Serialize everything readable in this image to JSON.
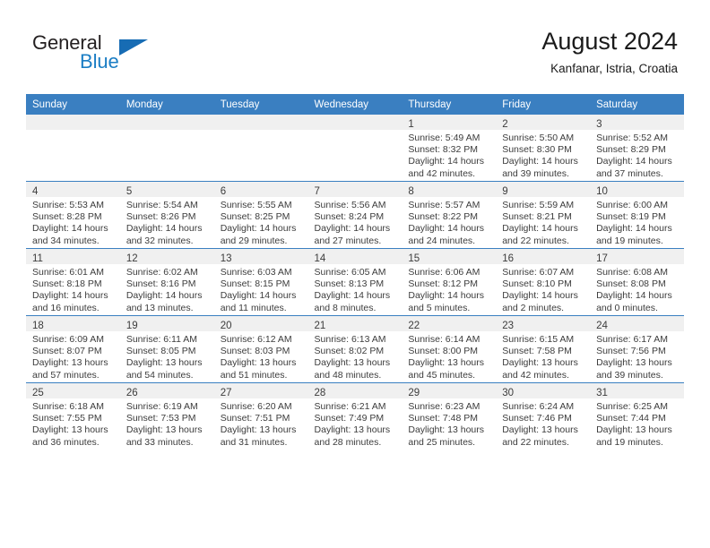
{
  "brand": {
    "name_part1": "General",
    "name_part2": "Blue",
    "triangle_color": "#176cb4",
    "blue_color": "#1a7dc4"
  },
  "header": {
    "month_title": "August 2024",
    "location": "Kanfanar, Istria, Croatia",
    "header_bg_color": "#3a7fc1"
  },
  "calendar": {
    "weekday_headers": [
      "Sunday",
      "Monday",
      "Tuesday",
      "Wednesday",
      "Thursday",
      "Friday",
      "Saturday"
    ],
    "weeks": [
      [
        {
          "day": "",
          "lines": []
        },
        {
          "day": "",
          "lines": []
        },
        {
          "day": "",
          "lines": []
        },
        {
          "day": "",
          "lines": []
        },
        {
          "day": "1",
          "lines": [
            "Sunrise: 5:49 AM",
            "Sunset: 8:32 PM",
            "Daylight: 14 hours",
            "and 42 minutes."
          ]
        },
        {
          "day": "2",
          "lines": [
            "Sunrise: 5:50 AM",
            "Sunset: 8:30 PM",
            "Daylight: 14 hours",
            "and 39 minutes."
          ]
        },
        {
          "day": "3",
          "lines": [
            "Sunrise: 5:52 AM",
            "Sunset: 8:29 PM",
            "Daylight: 14 hours",
            "and 37 minutes."
          ]
        }
      ],
      [
        {
          "day": "4",
          "lines": [
            "Sunrise: 5:53 AM",
            "Sunset: 8:28 PM",
            "Daylight: 14 hours",
            "and 34 minutes."
          ]
        },
        {
          "day": "5",
          "lines": [
            "Sunrise: 5:54 AM",
            "Sunset: 8:26 PM",
            "Daylight: 14 hours",
            "and 32 minutes."
          ]
        },
        {
          "day": "6",
          "lines": [
            "Sunrise: 5:55 AM",
            "Sunset: 8:25 PM",
            "Daylight: 14 hours",
            "and 29 minutes."
          ]
        },
        {
          "day": "7",
          "lines": [
            "Sunrise: 5:56 AM",
            "Sunset: 8:24 PM",
            "Daylight: 14 hours",
            "and 27 minutes."
          ]
        },
        {
          "day": "8",
          "lines": [
            "Sunrise: 5:57 AM",
            "Sunset: 8:22 PM",
            "Daylight: 14 hours",
            "and 24 minutes."
          ]
        },
        {
          "day": "9",
          "lines": [
            "Sunrise: 5:59 AM",
            "Sunset: 8:21 PM",
            "Daylight: 14 hours",
            "and 22 minutes."
          ]
        },
        {
          "day": "10",
          "lines": [
            "Sunrise: 6:00 AM",
            "Sunset: 8:19 PM",
            "Daylight: 14 hours",
            "and 19 minutes."
          ]
        }
      ],
      [
        {
          "day": "11",
          "lines": [
            "Sunrise: 6:01 AM",
            "Sunset: 8:18 PM",
            "Daylight: 14 hours",
            "and 16 minutes."
          ]
        },
        {
          "day": "12",
          "lines": [
            "Sunrise: 6:02 AM",
            "Sunset: 8:16 PM",
            "Daylight: 14 hours",
            "and 13 minutes."
          ]
        },
        {
          "day": "13",
          "lines": [
            "Sunrise: 6:03 AM",
            "Sunset: 8:15 PM",
            "Daylight: 14 hours",
            "and 11 minutes."
          ]
        },
        {
          "day": "14",
          "lines": [
            "Sunrise: 6:05 AM",
            "Sunset: 8:13 PM",
            "Daylight: 14 hours",
            "and 8 minutes."
          ]
        },
        {
          "day": "15",
          "lines": [
            "Sunrise: 6:06 AM",
            "Sunset: 8:12 PM",
            "Daylight: 14 hours",
            "and 5 minutes."
          ]
        },
        {
          "day": "16",
          "lines": [
            "Sunrise: 6:07 AM",
            "Sunset: 8:10 PM",
            "Daylight: 14 hours",
            "and 2 minutes."
          ]
        },
        {
          "day": "17",
          "lines": [
            "Sunrise: 6:08 AM",
            "Sunset: 8:08 PM",
            "Daylight: 14 hours",
            "and 0 minutes."
          ]
        }
      ],
      [
        {
          "day": "18",
          "lines": [
            "Sunrise: 6:09 AM",
            "Sunset: 8:07 PM",
            "Daylight: 13 hours",
            "and 57 minutes."
          ]
        },
        {
          "day": "19",
          "lines": [
            "Sunrise: 6:11 AM",
            "Sunset: 8:05 PM",
            "Daylight: 13 hours",
            "and 54 minutes."
          ]
        },
        {
          "day": "20",
          "lines": [
            "Sunrise: 6:12 AM",
            "Sunset: 8:03 PM",
            "Daylight: 13 hours",
            "and 51 minutes."
          ]
        },
        {
          "day": "21",
          "lines": [
            "Sunrise: 6:13 AM",
            "Sunset: 8:02 PM",
            "Daylight: 13 hours",
            "and 48 minutes."
          ]
        },
        {
          "day": "22",
          "lines": [
            "Sunrise: 6:14 AM",
            "Sunset: 8:00 PM",
            "Daylight: 13 hours",
            "and 45 minutes."
          ]
        },
        {
          "day": "23",
          "lines": [
            "Sunrise: 6:15 AM",
            "Sunset: 7:58 PM",
            "Daylight: 13 hours",
            "and 42 minutes."
          ]
        },
        {
          "day": "24",
          "lines": [
            "Sunrise: 6:17 AM",
            "Sunset: 7:56 PM",
            "Daylight: 13 hours",
            "and 39 minutes."
          ]
        }
      ],
      [
        {
          "day": "25",
          "lines": [
            "Sunrise: 6:18 AM",
            "Sunset: 7:55 PM",
            "Daylight: 13 hours",
            "and 36 minutes."
          ]
        },
        {
          "day": "26",
          "lines": [
            "Sunrise: 6:19 AM",
            "Sunset: 7:53 PM",
            "Daylight: 13 hours",
            "and 33 minutes."
          ]
        },
        {
          "day": "27",
          "lines": [
            "Sunrise: 6:20 AM",
            "Sunset: 7:51 PM",
            "Daylight: 13 hours",
            "and 31 minutes."
          ]
        },
        {
          "day": "28",
          "lines": [
            "Sunrise: 6:21 AM",
            "Sunset: 7:49 PM",
            "Daylight: 13 hours",
            "and 28 minutes."
          ]
        },
        {
          "day": "29",
          "lines": [
            "Sunrise: 6:23 AM",
            "Sunset: 7:48 PM",
            "Daylight: 13 hours",
            "and 25 minutes."
          ]
        },
        {
          "day": "30",
          "lines": [
            "Sunrise: 6:24 AM",
            "Sunset: 7:46 PM",
            "Daylight: 13 hours",
            "and 22 minutes."
          ]
        },
        {
          "day": "31",
          "lines": [
            "Sunrise: 6:25 AM",
            "Sunset: 7:44 PM",
            "Daylight: 13 hours",
            "and 19 minutes."
          ]
        }
      ]
    ]
  }
}
